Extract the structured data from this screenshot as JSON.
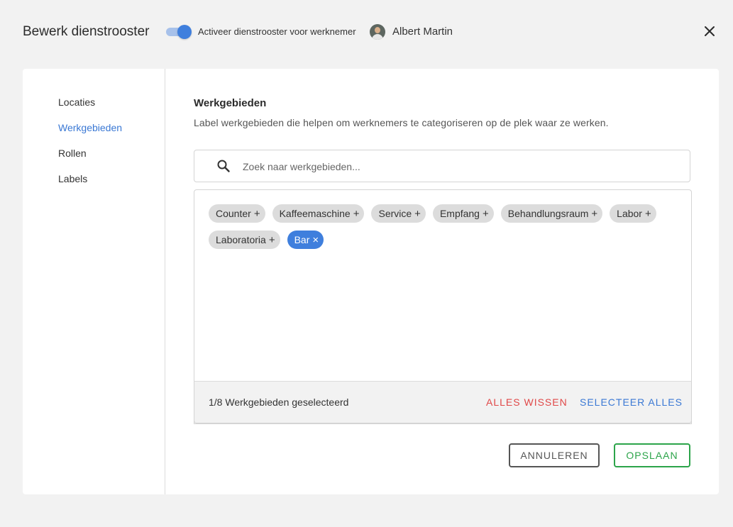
{
  "header": {
    "title": "Bewerk dienstrooster",
    "toggle_label": "Activeer dienstrooster voor werknemer",
    "toggle_on": true,
    "user_name": "Albert Martin",
    "accent_color": "#3f7fdd"
  },
  "sidebar": {
    "items": [
      {
        "label": "Locaties",
        "active": false
      },
      {
        "label": "Werkgebieden",
        "active": true
      },
      {
        "label": "Rollen",
        "active": false
      },
      {
        "label": "Labels",
        "active": false
      }
    ]
  },
  "main": {
    "title": "Werkgebieden",
    "description": "Label werkgebieden die helpen om werknemers te categoriseren op de plek waar ze werken.",
    "search": {
      "placeholder": "Zoek naar werkgebieden...",
      "value": "",
      "icon": "search-icon"
    },
    "tags": [
      {
        "label": "Counter",
        "selected": false
      },
      {
        "label": "Kaffeemaschine",
        "selected": false
      },
      {
        "label": "Service",
        "selected": false
      },
      {
        "label": "Empfang",
        "selected": false
      },
      {
        "label": "Behandlungsraum",
        "selected": false
      },
      {
        "label": "Labor",
        "selected": false
      },
      {
        "label": "Laboratoria",
        "selected": false
      },
      {
        "label": "Bar",
        "selected": true
      }
    ],
    "footer": {
      "count_text": "1/8 Werkgebieden geselecteerd",
      "clear_all": "ALLES WISSEN",
      "select_all": "SELECTEER ALLES",
      "clear_color": "#e04848",
      "select_color": "#3a78d4"
    }
  },
  "actions": {
    "cancel": "ANNULEREN",
    "save": "OPSLAAN",
    "save_color": "#2ca44a"
  }
}
